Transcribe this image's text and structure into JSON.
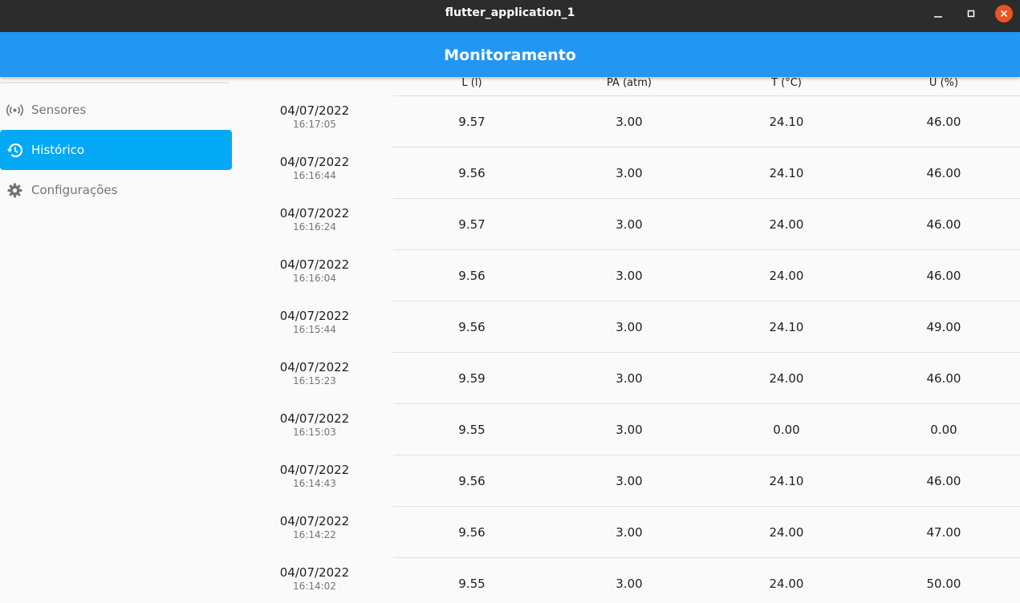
{
  "window": {
    "title": "flutter_application_1",
    "close_color": "#e95420"
  },
  "appbar": {
    "title": "Monitoramento",
    "color": "#2196f3"
  },
  "sidebar": {
    "items": [
      {
        "label": "Sensores",
        "icon": "sensors-icon",
        "active": false
      },
      {
        "label": "Histórico",
        "icon": "history-icon",
        "active": true
      },
      {
        "label": "Configurações",
        "icon": "settings-gear-icon",
        "active": false
      }
    ],
    "active_color": "#03a9f4"
  },
  "table": {
    "headers": [
      "L (l)",
      "PA (atm)",
      "T (°C)",
      "U (%)"
    ],
    "rows": [
      {
        "date": "04/07/2022",
        "time": "16:17:05",
        "values": [
          "9.57",
          "3.00",
          "24.10",
          "46.00"
        ]
      },
      {
        "date": "04/07/2022",
        "time": "16:16:44",
        "values": [
          "9.56",
          "3.00",
          "24.10",
          "46.00"
        ]
      },
      {
        "date": "04/07/2022",
        "time": "16:16:24",
        "values": [
          "9.57",
          "3.00",
          "24.00",
          "46.00"
        ]
      },
      {
        "date": "04/07/2022",
        "time": "16:16:04",
        "values": [
          "9.56",
          "3.00",
          "24.00",
          "46.00"
        ]
      },
      {
        "date": "04/07/2022",
        "time": "16:15:44",
        "values": [
          "9.56",
          "3.00",
          "24.10",
          "49.00"
        ]
      },
      {
        "date": "04/07/2022",
        "time": "16:15:23",
        "values": [
          "9.59",
          "3.00",
          "24.00",
          "46.00"
        ]
      },
      {
        "date": "04/07/2022",
        "time": "16:15:03",
        "values": [
          "9.55",
          "3.00",
          "0.00",
          "0.00"
        ]
      },
      {
        "date": "04/07/2022",
        "time": "16:14:43",
        "values": [
          "9.56",
          "3.00",
          "24.10",
          "46.00"
        ]
      },
      {
        "date": "04/07/2022",
        "time": "16:14:22",
        "values": [
          "9.56",
          "3.00",
          "24.00",
          "47.00"
        ]
      },
      {
        "date": "04/07/2022",
        "time": "16:14:02",
        "values": [
          "9.55",
          "3.00",
          "24.00",
          "50.00"
        ]
      }
    ]
  }
}
